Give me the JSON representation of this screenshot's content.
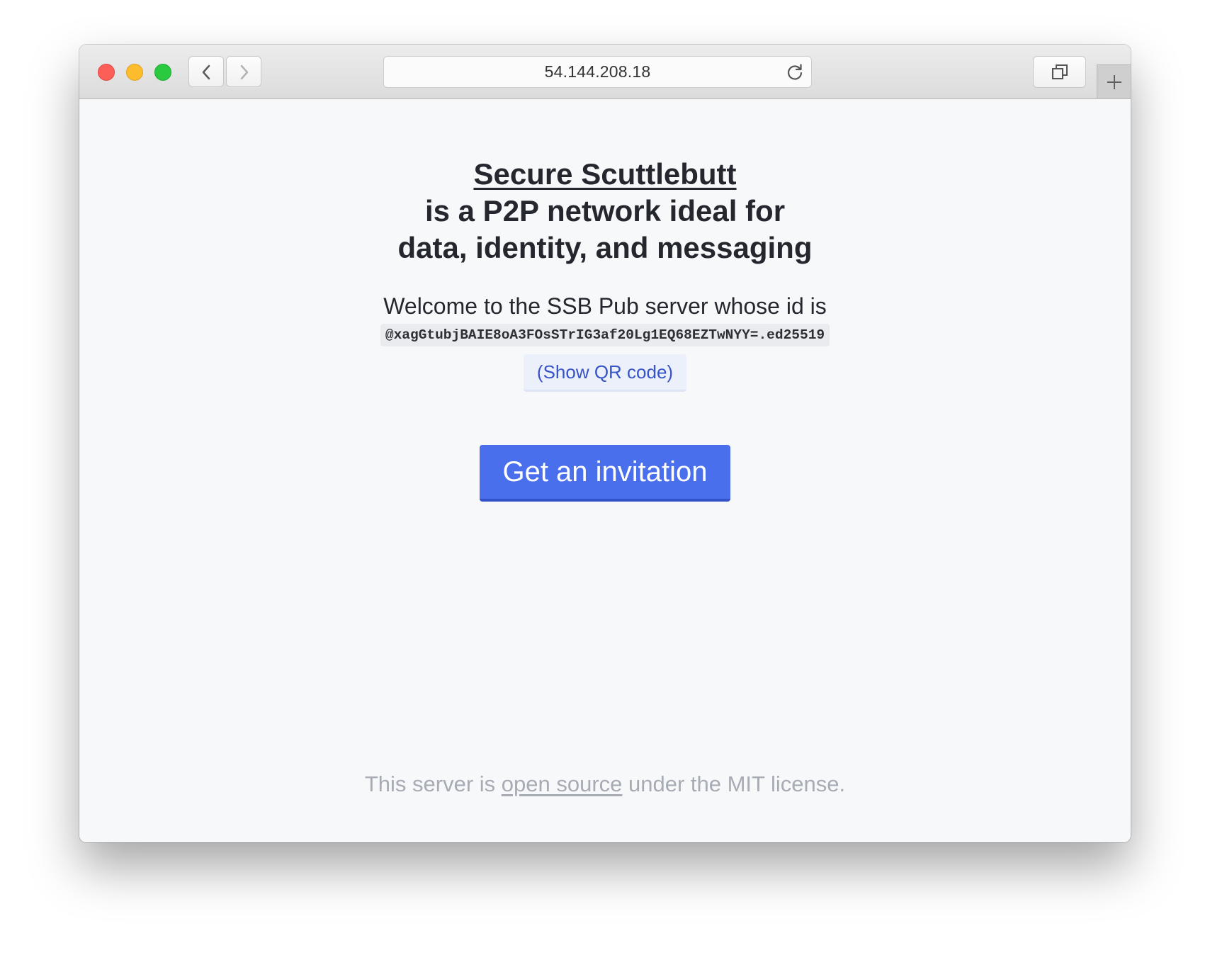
{
  "browser": {
    "url": "54.144.208.18",
    "icons": {
      "back": "chevron-left-icon",
      "forward": "chevron-right-icon",
      "reload": "reload-icon",
      "tabs": "tab-overview-icon",
      "new_tab": "plus-icon"
    },
    "colors": {
      "close": "#fc5f57",
      "minimize": "#fdbc2e",
      "maximize": "#29c940"
    }
  },
  "page": {
    "headline": {
      "link": "Secure Scuttlebutt",
      "line2": "is a P2P network ideal for",
      "line3": "data, identity, and messaging"
    },
    "welcome": "Welcome to the SSB Pub server whose id is",
    "pub_id": "@xagGtubjBAIE8oA3FOsSTrIG3af20Lg1EQ68EZTwNYY=.ed25519",
    "qr_button": "(Show QR code)",
    "invite_button": "Get an invitation",
    "footer": {
      "prefix": "This server is ",
      "link": "open source",
      "suffix": " under the MIT license."
    },
    "colors": {
      "accent": "#4a6fec",
      "text": "#24272e",
      "muted": "#a6abb4",
      "qr_text": "#3653c7"
    }
  }
}
